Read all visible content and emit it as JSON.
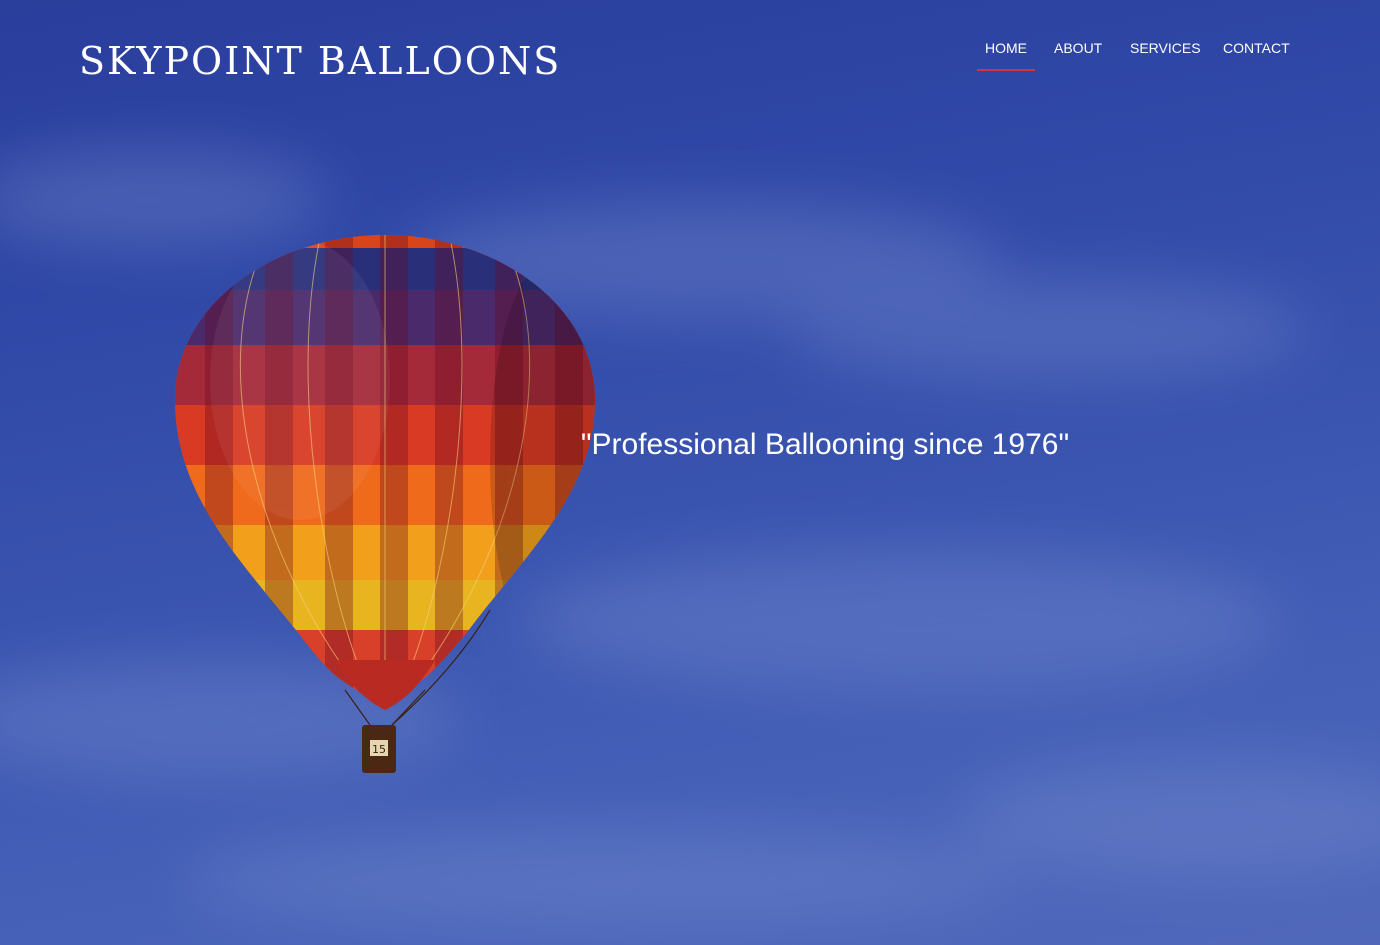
{
  "site": {
    "logo_text": "SKYPOINT BALLOONS"
  },
  "nav": {
    "items": [
      {
        "label": "HOME",
        "active": true
      },
      {
        "label": "ABOUT",
        "active": false
      },
      {
        "label": "SERVICES",
        "active": false
      },
      {
        "label": "CONTACT",
        "active": false
      }
    ]
  },
  "hero": {
    "tagline": "\"Professional Ballooning since 1976\"",
    "basket_number": "15"
  },
  "colors": {
    "sky": "#3a55b0",
    "nav_active_underline": "#d6323a",
    "text": "#ffffff"
  }
}
